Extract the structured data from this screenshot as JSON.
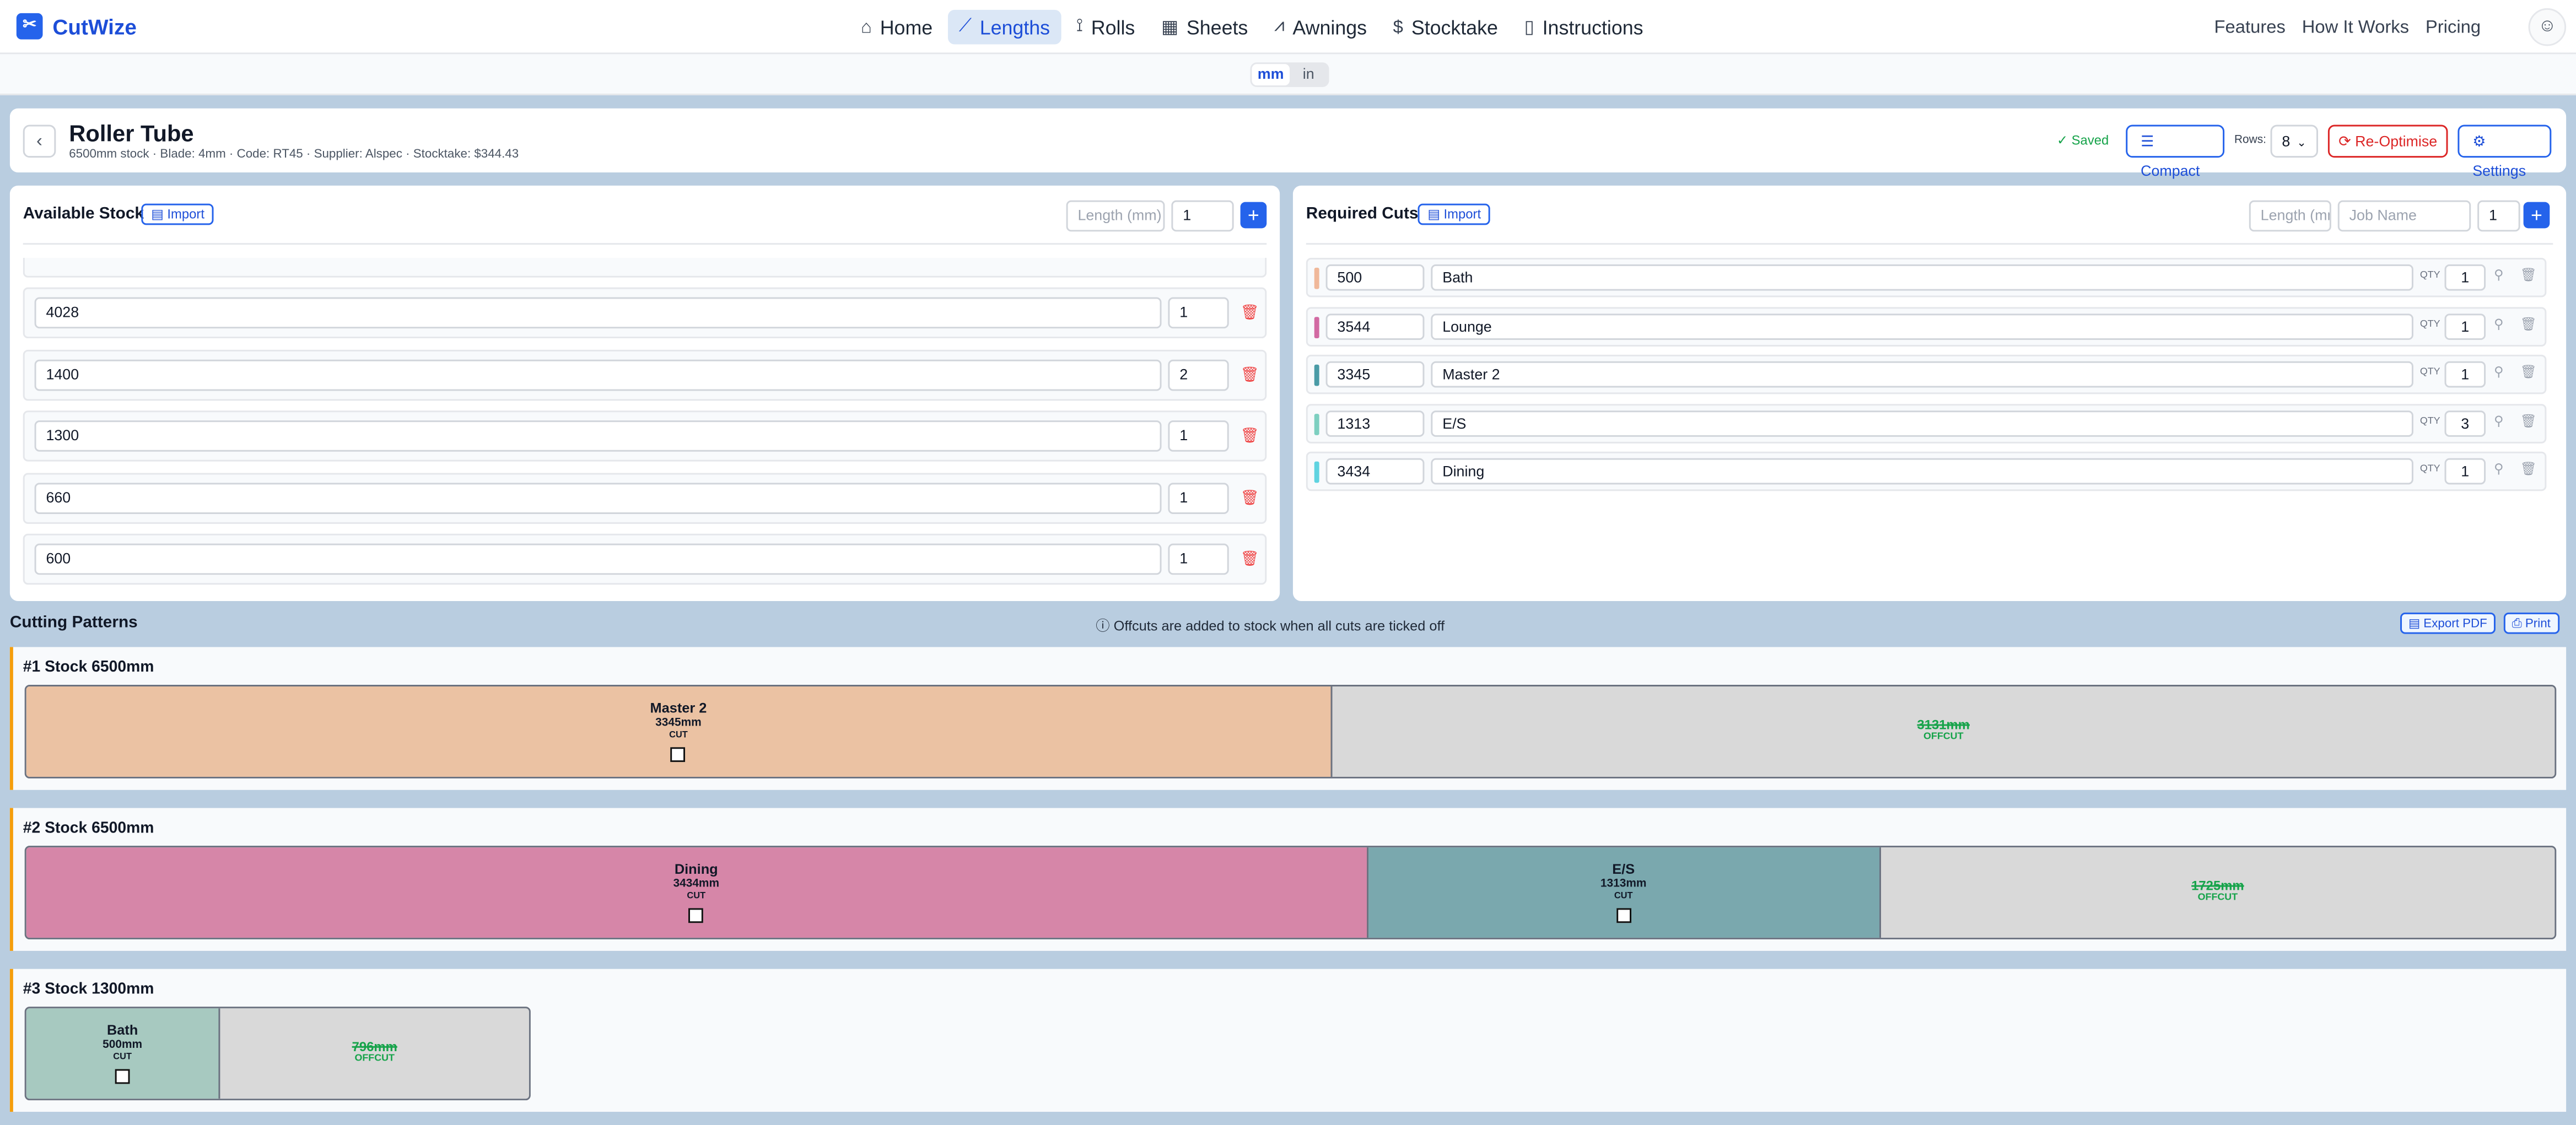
{
  "nav": {
    "logo": "CutWize",
    "links": [
      {
        "label": "Home",
        "icon": "⌂"
      },
      {
        "label": "Lengths",
        "icon": "⟋"
      },
      {
        "label": "Rolls",
        "icon": "⟟"
      },
      {
        "label": "Sheets",
        "icon": "▦"
      },
      {
        "label": "Awnings",
        "icon": "⩘"
      },
      {
        "label": "Stocktake",
        "icon": "$"
      },
      {
        "label": "Instructions",
        "icon": "▯"
      }
    ],
    "right_links": [
      "Features",
      "How It Works",
      "Pricing"
    ],
    "active_color": "#1d4ed8"
  },
  "units": {
    "mm": "mm",
    "in": "in",
    "selected": "mm"
  },
  "header": {
    "title": "Roller Tube",
    "subtitle": "6500mm stock · Blade: 4mm · Code: RT45 · Supplier: Alspec · Stocktake: $344.43",
    "saved": "✓ Saved",
    "compact": "Compact",
    "rows_label": "Rows:",
    "rows_value": "8",
    "reoptimise": "Re-Optimise",
    "settings": "Settings"
  },
  "available_stock": {
    "title": "Available Stock",
    "import": "Import",
    "length_placeholder": "Length (mm)",
    "qty_value": "1",
    "items": [
      {
        "length": "4028",
        "qty": "1"
      },
      {
        "length": "1400",
        "qty": "2"
      },
      {
        "length": "1300",
        "qty": "1"
      },
      {
        "length": "660",
        "qty": "1"
      },
      {
        "length": "600",
        "qty": "1"
      }
    ]
  },
  "required_cuts": {
    "title": "Required Cuts",
    "import": "Import",
    "length_placeholder": "Length (mm)",
    "job_placeholder": "Job Name",
    "qty_value": "1",
    "qty_label": "QTY",
    "items": [
      {
        "length": "500",
        "name": "Bath",
        "qty": "1",
        "color": "#f0b89a"
      },
      {
        "length": "3544",
        "name": "Lounge",
        "qty": "1",
        "color": "#d26aa3"
      },
      {
        "length": "3345",
        "name": "Master 2",
        "qty": "1",
        "color": "#4a9ba6"
      },
      {
        "length": "1313",
        "name": "E/S",
        "qty": "3",
        "color": "#7dcfc0"
      },
      {
        "length": "3434",
        "name": "Dining",
        "qty": "1",
        "color": "#5fd3e0"
      }
    ]
  },
  "patterns": {
    "title": "Cutting Patterns",
    "info": "Offcuts are added to stock when all cuts are ticked off",
    "export_pdf": "Export PDF",
    "print": "Print",
    "cut_label": "CUT",
    "offcut_label": "OFFCUT",
    "stocks": [
      {
        "title": "#1 Stock 6500mm",
        "length": 6500,
        "segments": [
          {
            "name": "Master 2",
            "mm": "3345mm",
            "value": 3345,
            "color": "#ebc2a3"
          },
          {
            "offcut": true,
            "mm": "3131mm",
            "value": 3131
          }
        ]
      },
      {
        "title": "#2 Stock 6500mm",
        "length": 6500,
        "segments": [
          {
            "name": "Dining",
            "mm": "3434mm",
            "value": 3434,
            "color": "#d686a8"
          },
          {
            "name": "E/S",
            "mm": "1313mm",
            "value": 1313,
            "color": "#7aa8ae"
          },
          {
            "offcut": true,
            "mm": "1725mm",
            "value": 1725
          }
        ]
      },
      {
        "title": "#3 Stock 1300mm",
        "length": 1300,
        "segments": [
          {
            "name": "Bath",
            "mm": "500mm",
            "value": 500,
            "color": "#a7c9c0"
          },
          {
            "offcut": true,
            "mm": "796mm",
            "value": 796
          }
        ]
      }
    ]
  }
}
